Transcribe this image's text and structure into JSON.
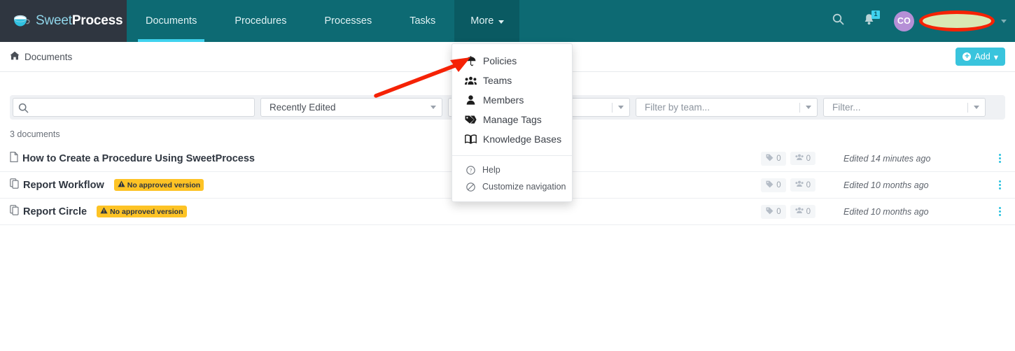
{
  "brand": {
    "logo_sweet": "Sweet",
    "logo_process": "Process",
    "logo_icon": "coffee-cup-icon",
    "nav_bg": "#0d6a73",
    "logo_bg": "#2f3640",
    "accent": "#3fd2ee"
  },
  "nav": {
    "tabs": [
      {
        "label": "Documents",
        "active": true
      },
      {
        "label": "Procedures",
        "active": false
      },
      {
        "label": "Processes",
        "active": false
      },
      {
        "label": "Tasks",
        "active": false
      }
    ],
    "more_label": "More",
    "search_icon": "search-icon",
    "bell_icon": "bell-icon",
    "bell_badge": "1",
    "avatar_initials": "CO",
    "user_name_redacted": ""
  },
  "dropdown": {
    "items": [
      {
        "label": "Policies",
        "icon": "umbrella-icon"
      },
      {
        "label": "Teams",
        "icon": "users-group-icon"
      },
      {
        "label": "Members",
        "icon": "user-icon"
      },
      {
        "label": "Manage Tags",
        "icon": "tag-icon"
      },
      {
        "label": "Knowledge Bases",
        "icon": "book-icon"
      }
    ],
    "footer_items": [
      {
        "label": "Help",
        "icon": "question-circle-icon"
      },
      {
        "label": "Customize navigation",
        "icon": "ban-circle-icon"
      }
    ]
  },
  "subheader": {
    "breadcrumb_icon": "home-icon",
    "breadcrumb": "Documents",
    "add_label": "Add",
    "add_caret": "▾",
    "add_color": "#39c4dd"
  },
  "filters": {
    "search_value": "",
    "search_placeholder": "",
    "search_icon": "search-icon",
    "sort_value": "Recently Edited",
    "hidden_value": "",
    "team_placeholder": "Filter by team...",
    "generic_placeholder": "Filter..."
  },
  "list": {
    "count_label": "3 documents",
    "documents": [
      {
        "title": "How to Create a Procedure Using SweetProcess",
        "icon": "file-icon",
        "badge": "",
        "tags": "0",
        "members": "0",
        "edited": "Edited 14 minutes ago"
      },
      {
        "title": "Report Workflow",
        "icon": "copy-icon",
        "badge": "No approved version",
        "tags": "0",
        "members": "0",
        "edited": "Edited 10 months ago"
      },
      {
        "title": "Report Circle",
        "icon": "copy-icon",
        "badge": "No approved version",
        "tags": "0",
        "members": "0",
        "edited": "Edited 10 months ago"
      }
    ],
    "badge_color": "#fdc325",
    "kebab_color": "#2cc3e0"
  },
  "annotation": {
    "arrow_color": "#f52205",
    "redaction_fill": "#d9e8b4",
    "redaction_stroke": "#f52205"
  }
}
